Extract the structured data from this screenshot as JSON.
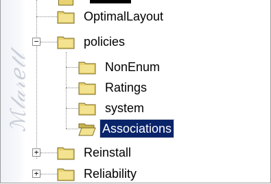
{
  "tree": {
    "items": [
      {
        "label": "OptimalLayout",
        "expander": ""
      },
      {
        "label": "policies",
        "expander": "−"
      },
      {
        "label": "NonEnum",
        "expander": ""
      },
      {
        "label": "Ratings",
        "expander": ""
      },
      {
        "label": "system",
        "expander": ""
      },
      {
        "label": "Associations",
        "expander": "",
        "selected": true,
        "open": true
      },
      {
        "label": "Reinstall",
        "expander": "+"
      },
      {
        "label": "Reliability",
        "expander": "+"
      }
    ]
  },
  "colors": {
    "selection": "#0a246a",
    "folder_fill": "#e8d271",
    "folder_edge": "#7a6a20"
  },
  "icons": {
    "folder": "folder-icon",
    "open_folder": "open-folder-icon",
    "expand": "plus-icon",
    "collapse": "minus-icon"
  }
}
